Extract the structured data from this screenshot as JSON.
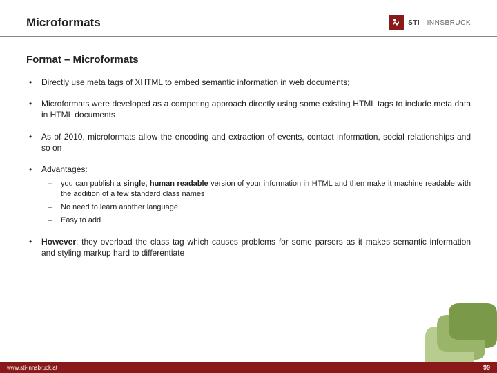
{
  "header": {
    "title": "Microformats",
    "logo": {
      "brand": "STI",
      "sep": " · ",
      "loc": "INNSBRUCK"
    }
  },
  "section_title": "Format – Microformats",
  "bullets": [
    {
      "text": "Directly use meta tags of XHTML to embed semantic information in web documents;"
    },
    {
      "text": "Microformats were developed as a competing approach directly using some existing HTML tags to include meta data in HTML documents"
    },
    {
      "text": "As of 2010, microformats allow the encoding and extraction of events, contact information, social relationships and so on"
    },
    {
      "text": "Advantages:",
      "sub": [
        {
          "pre": "you can publish a ",
          "bold": "single, human readable",
          "post": " version of your information in HTML and then make it machine readable with the addition of a few standard class names"
        },
        {
          "pre": "No need to learn another language",
          "bold": "",
          "post": ""
        },
        {
          "pre": "Easy to add",
          "bold": "",
          "post": ""
        }
      ]
    },
    {
      "bold_lead": "However",
      "text": ": they overload the class tag which causes problems for some parsers as it makes semantic information and styling markup hard to differentiate"
    }
  ],
  "footer": {
    "url": "www.sti-innsbruck.at",
    "page": "99"
  }
}
